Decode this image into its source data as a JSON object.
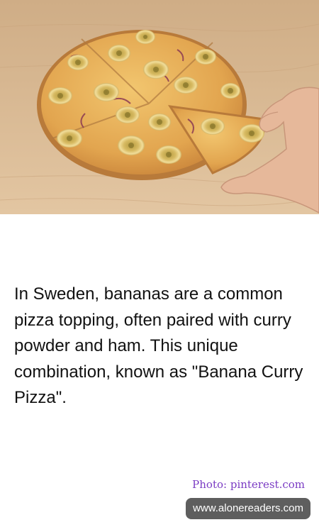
{
  "caption": {
    "text": "In Sweden, bananas are a common pizza topping, often paired with curry powder and ham. This unique combination, known as \"Banana Curry Pizza\"."
  },
  "credit": {
    "text": "Photo: pinterest.com"
  },
  "site": {
    "label": "www.alonereaders.com"
  },
  "colors": {
    "credit": "#7b3cc4",
    "badge_bg": "#5e5e5e",
    "table_wood": "#d9bb96",
    "cheese": "#e6b463",
    "banana": "#efd58a",
    "curry": "#7a6a24"
  }
}
